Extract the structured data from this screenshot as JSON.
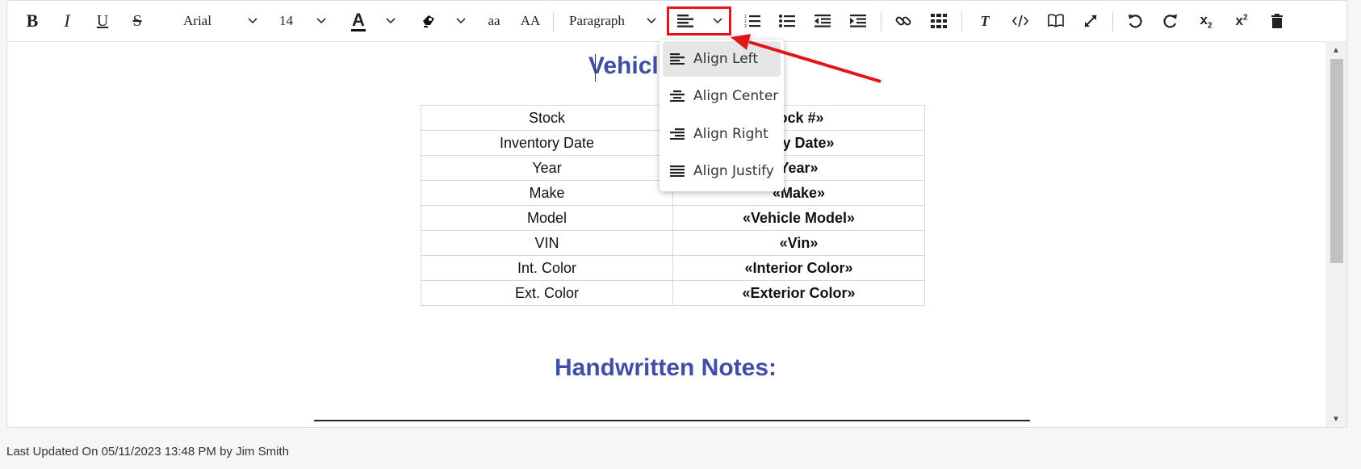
{
  "toolbar": {
    "bold": "B",
    "italic": "I",
    "underline": "U",
    "strike": "S",
    "font_family": "Arial",
    "font_size": "14",
    "text_color_letter": "A",
    "lowercase": "aa",
    "uppercase": "AA",
    "block_format": "Paragraph",
    "subscript": "x",
    "subscript_mark": "2",
    "superscript": "x",
    "superscript_mark": "2",
    "clear_format": "T"
  },
  "icons": [
    "bold-icon",
    "italic-icon",
    "underline-icon",
    "strikethrough-icon",
    "text-color-icon",
    "highlight-icon",
    "align-left-icon",
    "numbered-list-icon",
    "bullet-list-icon",
    "outdent-icon",
    "indent-icon",
    "link-icon",
    "table-icon",
    "clear-format-icon",
    "code-view-icon",
    "book-icon",
    "fullscreen-icon",
    "undo-icon",
    "redo-icon",
    "subscript-icon",
    "superscript-icon",
    "delete-icon"
  ],
  "align_menu": {
    "items": [
      {
        "label": "Align Left",
        "selected": true
      },
      {
        "label": "Align Center",
        "selected": false
      },
      {
        "label": "Align Right",
        "selected": false
      },
      {
        "label": "Align Justify",
        "selected": false
      }
    ]
  },
  "document": {
    "title_visible": "Vehicl",
    "rows": [
      {
        "key": "Stock",
        "value": "tock #»"
      },
      {
        "key": "Inventory Date",
        "value": "tory Date»"
      },
      {
        "key": "Year",
        "value": "Year»"
      },
      {
        "key": "Make",
        "value": "«Make»"
      },
      {
        "key": "Model",
        "value": "«Vehicle Model»"
      },
      {
        "key": "VIN",
        "value": "«Vin»"
      },
      {
        "key": "Int. Color",
        "value": "«Interior Color»"
      },
      {
        "key": "Ext. Color",
        "value": "«Exterior Color»"
      }
    ],
    "notes_heading": "Handwritten Notes:"
  },
  "status_text": "Last Updated On 05/11/2023 13:48 PM by Jim Smith",
  "colors": {
    "heading": "#3f4fa8",
    "highlight_box": "#e2151b"
  }
}
